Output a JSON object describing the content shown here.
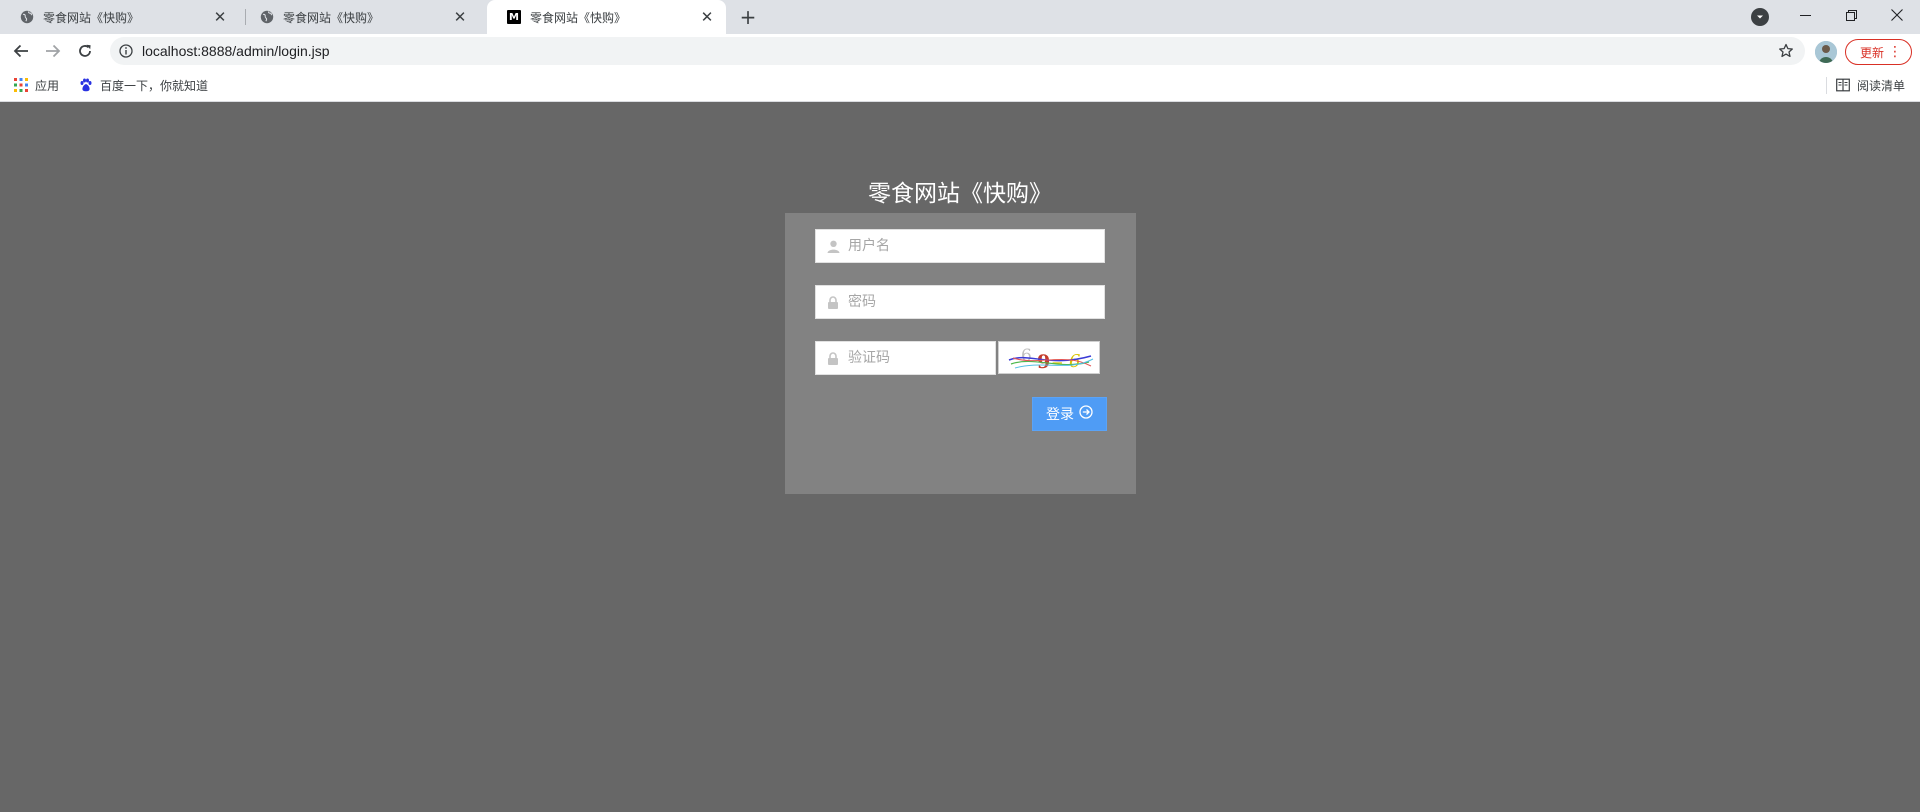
{
  "browser": {
    "tabs": [
      {
        "title": "零食网站《快购》",
        "favicon": "globe-icon",
        "active": false
      },
      {
        "title": "零食网站《快购》",
        "favicon": "globe-icon",
        "active": false
      },
      {
        "title": "零食网站《快购》",
        "favicon": "m-logo-icon",
        "favicon_letter": "M",
        "active": true
      }
    ],
    "url": "localhost:8888/admin/login.jsp",
    "update_label": "更新",
    "bookmarks": {
      "apps_label": "应用",
      "baidu_label": "百度一下，你就知道",
      "reading_list_label": "阅读清单"
    }
  },
  "page": {
    "title": "零食网站《快购》",
    "username_placeholder": "用户名",
    "password_placeholder": "密码",
    "captcha_placeholder": "验证码",
    "captcha_text": "6 9 = 6",
    "login_label": "登录"
  },
  "colors": {
    "page_background": "#676767",
    "login_box": "#828282",
    "login_button": "#4f9cf5",
    "update_accent": "#d93025"
  }
}
